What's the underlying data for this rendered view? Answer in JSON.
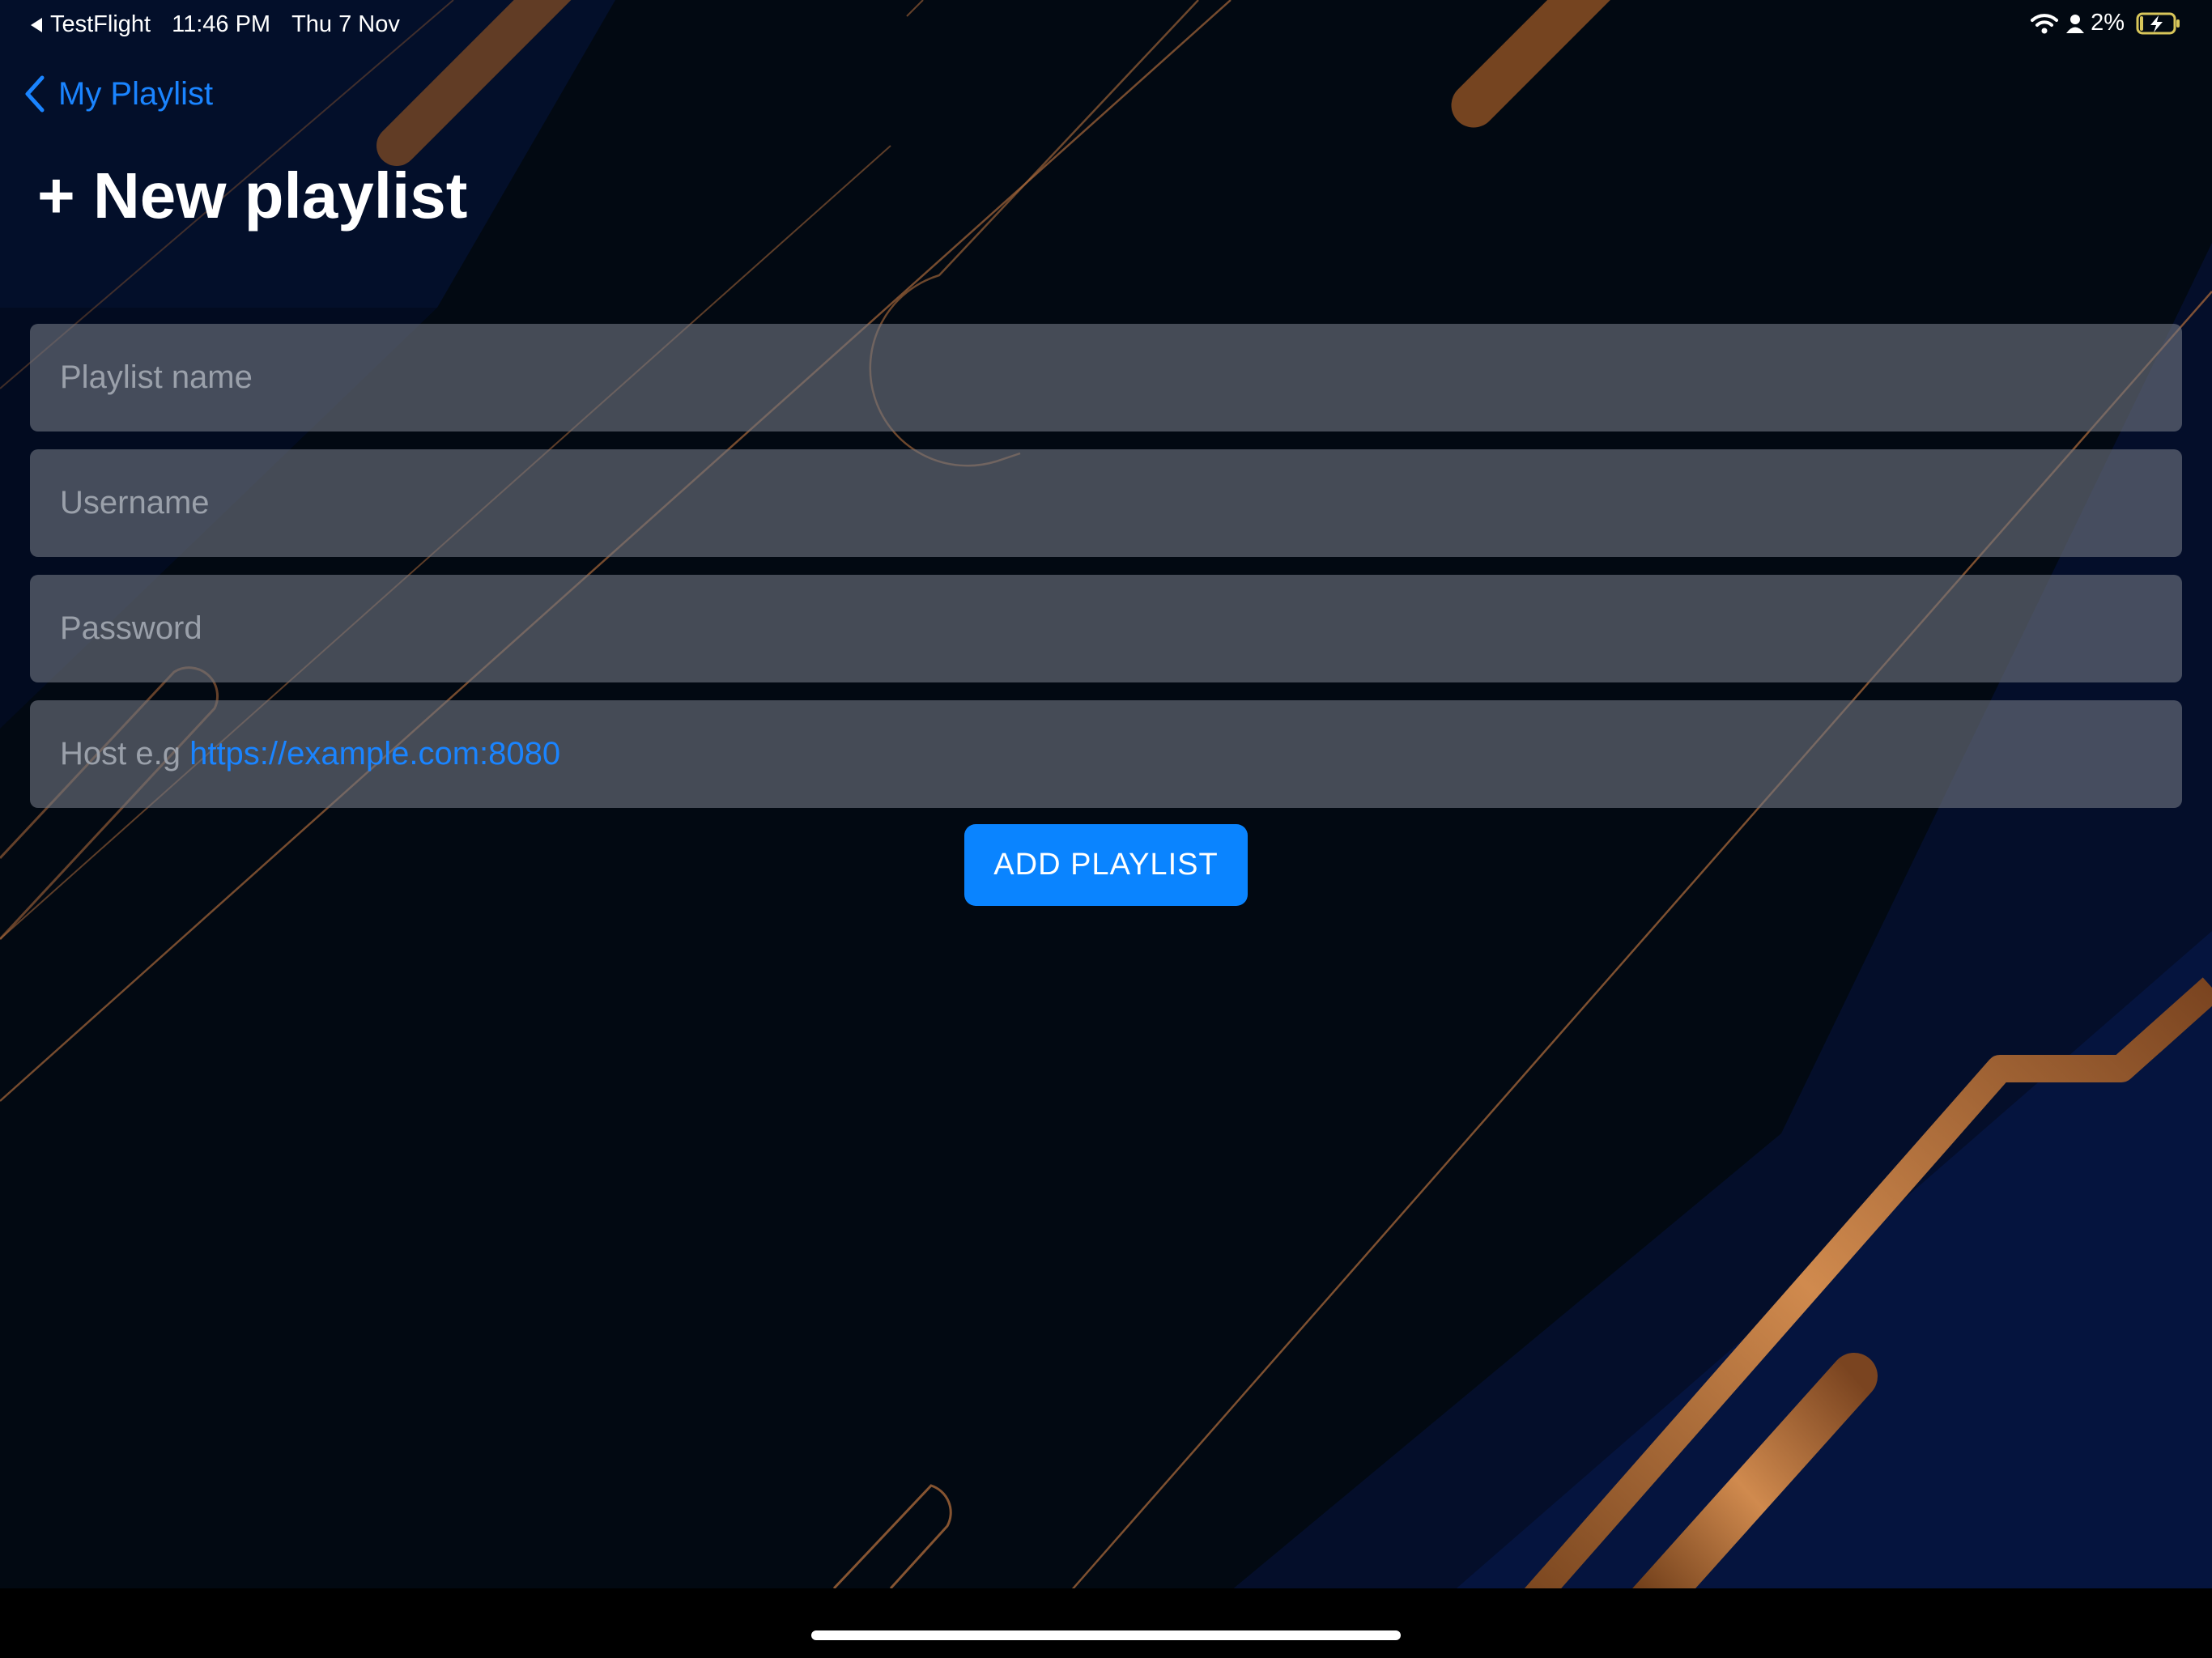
{
  "status_bar": {
    "back_app": "TestFlight",
    "time": "11:46 PM",
    "date": "Thu 7 Nov",
    "battery_percent": "2%",
    "icons": [
      "back-triangle-icon",
      "wifi-icon",
      "person-icon",
      "battery-charging-icon"
    ]
  },
  "nav": {
    "back_label": "My Playlist",
    "title": "+ New playlist"
  },
  "form": {
    "playlist_name": {
      "value": "",
      "placeholder": "Playlist name"
    },
    "username": {
      "value": "",
      "placeholder": "Username"
    },
    "password": {
      "value": "",
      "placeholder": "Password"
    },
    "host": {
      "value": "",
      "placeholder_prefix": "Host e.g ",
      "placeholder_link": "https://example.com:8080"
    }
  },
  "actions": {
    "add_label": "ADD PLAYLIST"
  },
  "colors": {
    "accent": "#0a84ff",
    "background": "#020912",
    "stripe_blue": "#0a1a4a",
    "copper": "#b8733d"
  }
}
